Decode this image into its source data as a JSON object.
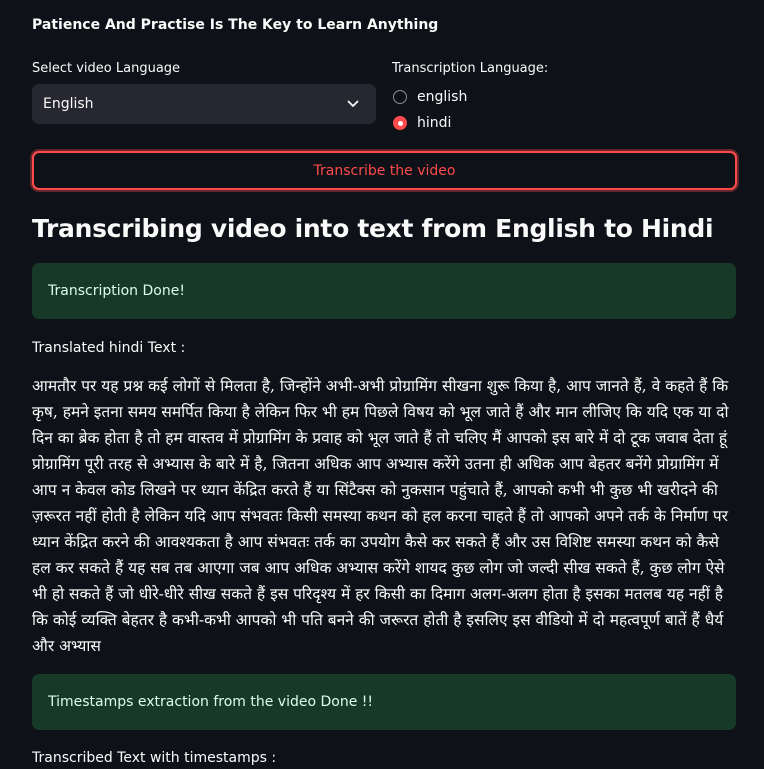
{
  "header": {
    "title": "Patience And Practise Is The Key to Learn Anything"
  },
  "video_language": {
    "label": "Select video Language",
    "selected": "English"
  },
  "transcription_language": {
    "label": "Transcription Language:",
    "options": [
      {
        "label": "english",
        "selected": false
      },
      {
        "label": "hindi",
        "selected": true
      }
    ]
  },
  "transcribe_button": {
    "label": "Transcribe the video"
  },
  "section": {
    "heading": "Transcribing video into text from English to Hindi"
  },
  "alerts": {
    "transcription": "Transcription Done!",
    "timestamps": "Timestamps extraction from the video Done !!"
  },
  "translated": {
    "label": "Translated hindi Text :",
    "text": "आमतौर पर यह प्रश्न कई लोगों से मिलता है, जिन्होंने अभी-अभी प्रोग्रामिंग सीखना शुरू किया है, आप जानते हैं, वे कहते हैं कि कृष, हमने इतना समय समर्पित किया है लेकिन फिर भी हम पिछले विषय को भूल जाते हैं और मान लीजिए कि यदि एक या दो दिन का ब्रेक होता है तो हम वास्तव में प्रोग्रामिंग के प्रवाह को भूल जाते हैं तो चलिए मैं आपको इस बारे में दो टूक जवाब देता हूं प्रोग्रामिंग पूरी तरह से अभ्यास के बारे में है, जितना अधिक आप अभ्यास करेंगे उतना ही अधिक आप बेहतर बनेंगे प्रोग्रामिंग में आप न केवल कोड लिखने पर ध्यान केंद्रित करते हैं या सिंटैक्स को नुकसान पहुंचाते हैं, आपको कभी भी कुछ भी खरीदने की ज़रूरत नहीं होती है लेकिन यदि आप संभवतः किसी समस्या कथन को हल करना चाहते हैं तो आपको अपने तर्क के निर्माण पर ध्यान केंद्रित करने की आवश्यकता है आप संभवतः तर्क का उपयोग कैसे कर सकते हैं और उस विशिष्ट समस्या कथन को कैसे हल कर सकते हैं यह सब तब आएगा जब आप अधिक अभ्यास करेंगे शायद कुछ लोग जो जल्दी सीख सकते हैं, कुछ लोग ऐसे भी हो सकते हैं जो धीरे-धीरे सीख सकते हैं इस परिदृश्य में हर किसी का दिमाग अलग-अलग होता है इसका मतलब यह नहीं है कि कोई व्यक्ति बेहतर है कभी-कभी आपको भी पति बनने की जरूरत होती है इसलिए इस वीडियो में दो महत्वपूर्ण बातें हैं धैर्य और अभ्यास"
  },
  "timestamps": {
    "label": "Transcribed Text with timestamps :"
  },
  "colors": {
    "background": "#0e1117",
    "accent": "#ff4b4b",
    "success_bg": "#173928",
    "input_bg": "#262730"
  }
}
